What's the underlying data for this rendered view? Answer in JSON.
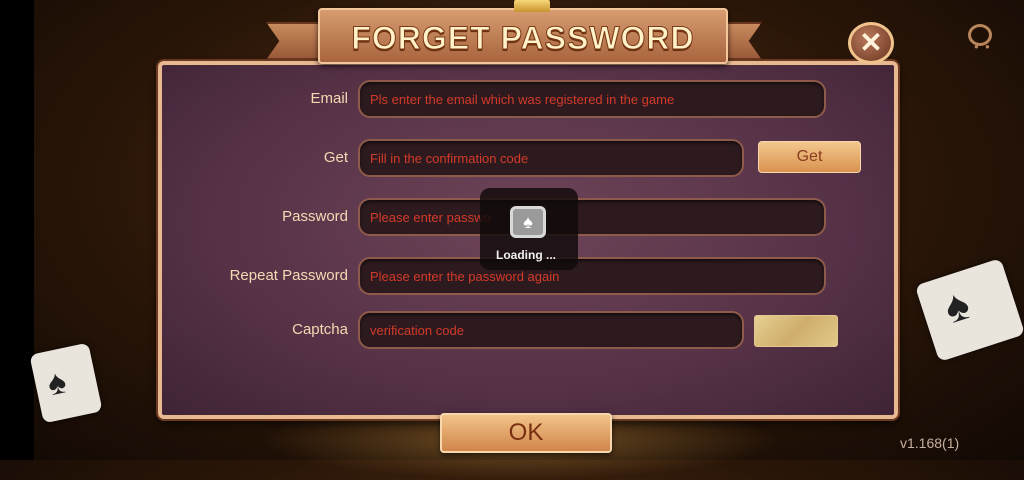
{
  "title": "FORGET PASSWORD",
  "form": {
    "email": {
      "label": "Email",
      "placeholder": "Pls enter the email which was registered in the game"
    },
    "get_code": {
      "label": "Get",
      "placeholder": "Fill in the confirmation code",
      "button": "Get"
    },
    "password": {
      "label": "Password",
      "placeholder": "Please enter passwo"
    },
    "repeat_password": {
      "label": "Repeat Password",
      "placeholder": "Please enter the password again"
    },
    "captcha": {
      "label": "Captcha",
      "placeholder": "verification code"
    }
  },
  "ok_button": "OK",
  "loading": {
    "text": "Loading",
    "dots": "..."
  },
  "version": "v1.168(1)",
  "icons": {
    "close": "close-icon",
    "support": "customer-support-icon",
    "loading": "spade-card-icon"
  },
  "colors": {
    "accent": "#d9924f",
    "panel": "#563247",
    "placeholder": "#d43a2a",
    "label": "#f3d9b4"
  }
}
